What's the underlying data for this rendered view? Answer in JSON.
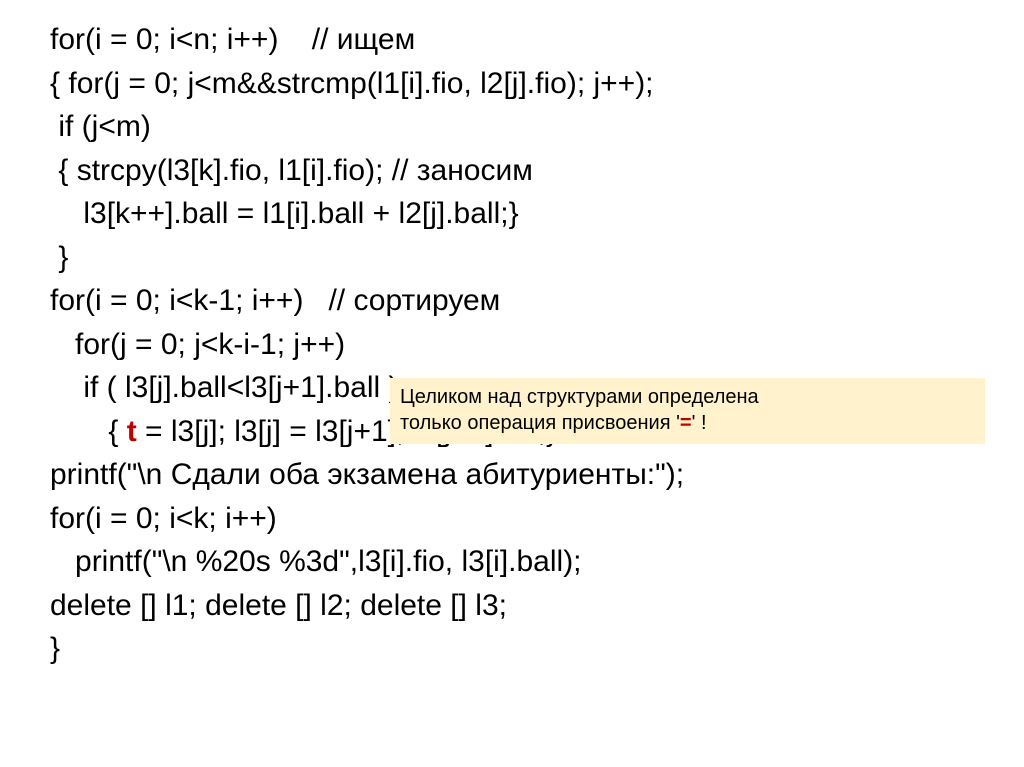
{
  "code": {
    "l1": "for(i = 0; i<n; i++)    // ищем",
    "l2": "{ for(j = 0; j<m&&strcmp(l1[i].fio, l2[j].fio); j++);",
    "l3": " if (j<m)",
    "l4": " { strcpy(l3[k].fio, l1[i].fio); // заносим",
    "l5": "    l3[k++].ball = l1[i].ball + l2[j].ball;}",
    "l6": " }",
    "l7": "for(i = 0; i<k-1; i++)   // сортируем",
    "l8": "   for(j = 0; j<k-i-1; j++)",
    "l9": "    if ( l3[j].ball<l3[j+1].ball )",
    "l10a": "       { ",
    "l10b": "t",
    "l10c": " = l3[j]; l3[j] = l3[j+1]; l3[j+1] = ",
    "l10d": "t",
    "l10e": ";}",
    "l11": "printf(\"\\n Сдали оба экзамена абитуриенты:\");",
    "l12": "for(i = 0; i<k; i++)",
    "l13": "   printf(\"\\n %20s %3d\",l3[i].fio, l3[i].ball);",
    "l14": "delete [] l1; delete [] l2; delete [] l3;",
    "l15": "}"
  },
  "note": {
    "line1": "Целиком над структурами определена",
    "line2a": "только операция присвоения '",
    "line2b": "=",
    "line2c": "' !"
  }
}
